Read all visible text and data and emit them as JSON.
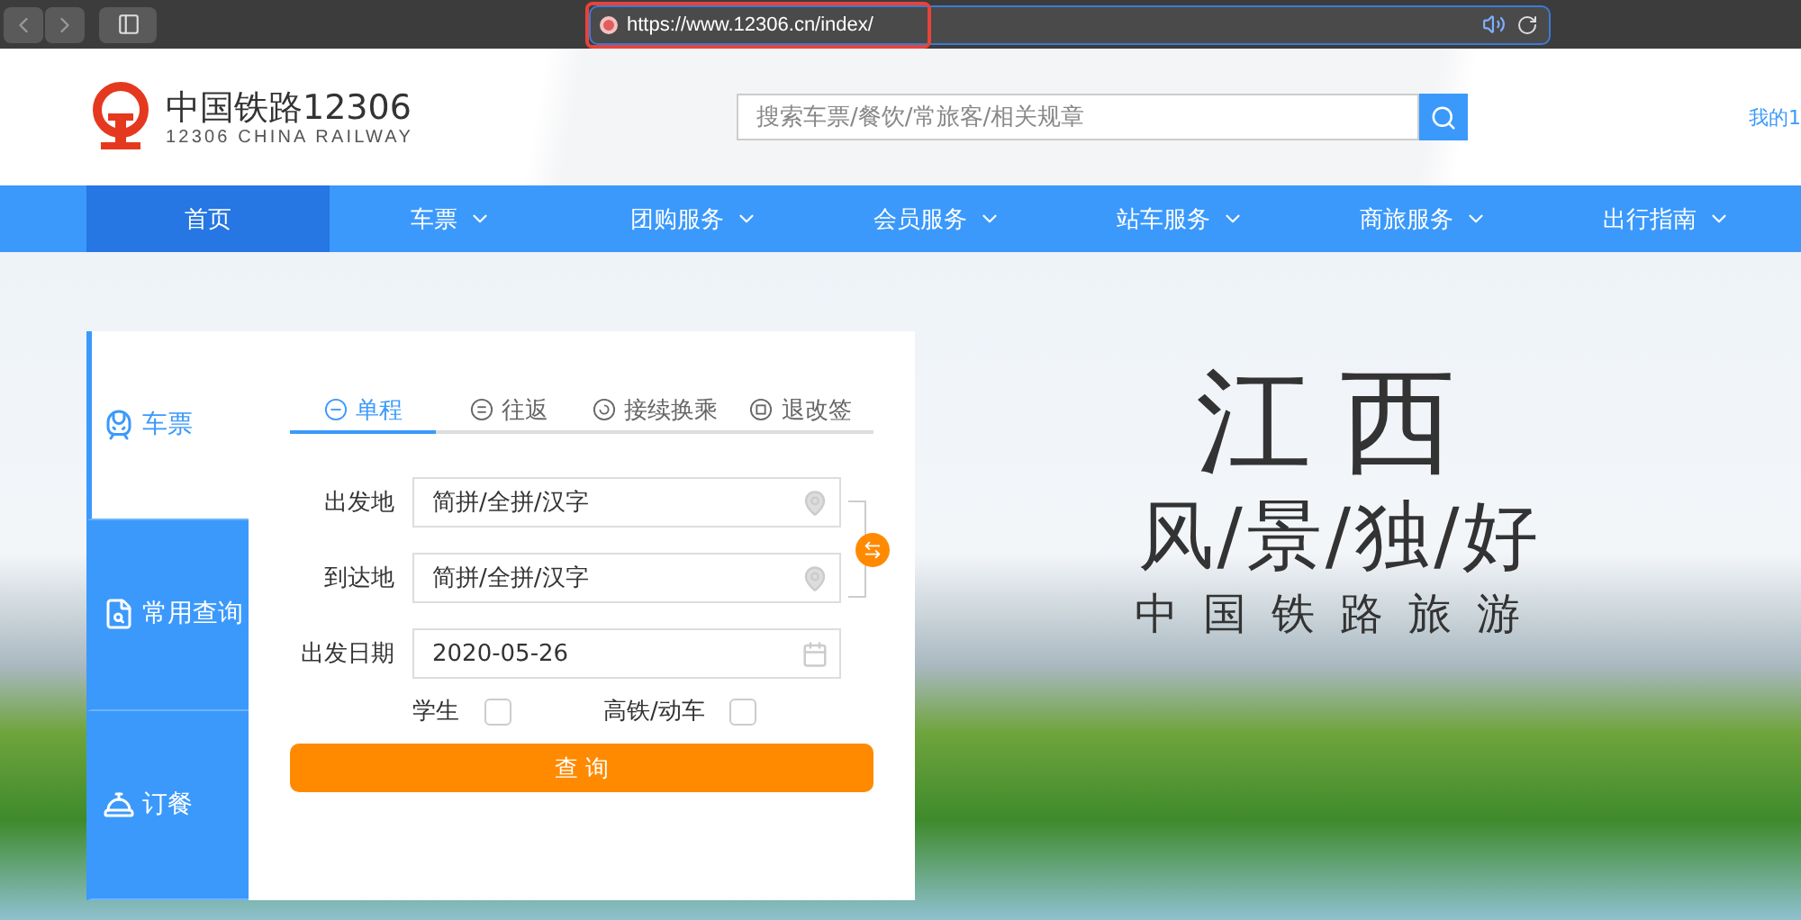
{
  "browser": {
    "url": "https://www.12306.cn/index/"
  },
  "header": {
    "logo_title": "中国铁路12306",
    "logo_subtitle": "12306 CHINA RAILWAY",
    "search_placeholder": "搜索车票/餐饮/常旅客/相关规章",
    "account_link": "我的1"
  },
  "nav": [
    {
      "label": "首页",
      "selected": true,
      "dropdown": false
    },
    {
      "label": "车票",
      "selected": false,
      "dropdown": true
    },
    {
      "label": "团购服务",
      "selected": false,
      "dropdown": true
    },
    {
      "label": "会员服务",
      "selected": false,
      "dropdown": true
    },
    {
      "label": "站车服务",
      "selected": false,
      "dropdown": true
    },
    {
      "label": "商旅服务",
      "selected": false,
      "dropdown": true
    },
    {
      "label": "出行指南",
      "selected": false,
      "dropdown": true
    }
  ],
  "banner": {
    "title": "江西",
    "slogan": "风/景/独/好",
    "tagline": "中国铁路旅游"
  },
  "booking": {
    "side_tabs": [
      {
        "kind": "train",
        "label": "车票",
        "selected": true
      },
      {
        "kind": "query",
        "label": "常用查询",
        "selected": false
      },
      {
        "kind": "meal",
        "label": "订餐",
        "selected": false
      }
    ],
    "trip_tabs": [
      {
        "kind": "single",
        "label": "单程",
        "selected": true
      },
      {
        "kind": "return",
        "label": "往返",
        "selected": false
      },
      {
        "kind": "transfer",
        "label": "接续换乘",
        "selected": false
      },
      {
        "kind": "refund",
        "label": "退改签",
        "selected": false
      }
    ],
    "fields": [
      {
        "kind": "location",
        "label": "出发地",
        "placeholder": "简拼/全拼/汉字"
      },
      {
        "kind": "location",
        "label": "到达地",
        "placeholder": "简拼/全拼/汉字"
      },
      {
        "kind": "date",
        "label": "出发日期",
        "value": "2020-05-26"
      }
    ],
    "options": [
      {
        "label": "学生",
        "checked": false
      },
      {
        "label": "高铁/动车",
        "checked": false
      }
    ],
    "submit": "查 询"
  }
}
